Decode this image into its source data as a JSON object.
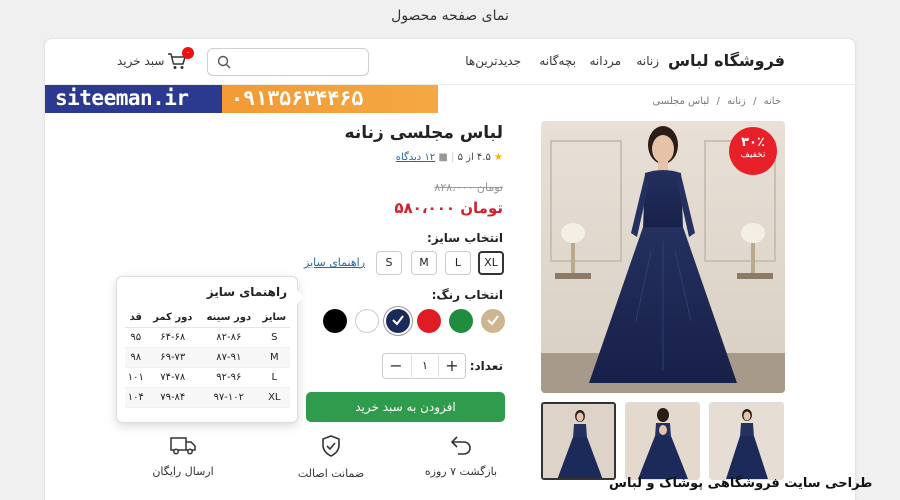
{
  "page_caption": "نمای صفحه محصول",
  "header": {
    "logo": "فروشگاه لباس",
    "nav": [
      {
        "label": "زنانه"
      },
      {
        "label": "مردانه"
      },
      {
        "label": "بچه‌گانه"
      },
      {
        "label": "جدیدترین‌ها"
      }
    ],
    "search_placeholder": "",
    "cart_label": "سبد خرید",
    "cart_count": "۰"
  },
  "banner": {
    "domain": "siteeman.ir",
    "phone": "۰۹۱۳۵۶۳۴۴۶۵"
  },
  "breadcrumb": [
    "خانه",
    "زنانه",
    "لباس مجلسی"
  ],
  "product": {
    "title": "لباس مجلسی زنانه",
    "rating_text": "۴.۵ از ۵",
    "reviews_text": "۱۲ دیدگاه",
    "old_price": "۸۲۸،۰۰۰ تومان",
    "new_price": "۵۸۰،۰۰۰ تومان",
    "discount_pct": "۳۰٪",
    "discount_label": "تخفیف"
  },
  "size_select": {
    "label": "انتخاب سایز:",
    "sizes": [
      "XL",
      "L",
      "M",
      "S"
    ],
    "selected": "XL",
    "guide_link": "راهنمای سایز"
  },
  "color_select": {
    "label": "انتخاب رنگ:",
    "colors": [
      "#cdb590",
      "#1f8c3e",
      "#e01b24",
      "#1c2a59",
      "#ffffff",
      "#000000"
    ],
    "selected_index": 3
  },
  "quantity": {
    "label": "تعداد:",
    "value": "۱"
  },
  "add_to_cart": "افزودن به سبد خرید",
  "features": [
    {
      "icon": "return-icon",
      "label": "بازگشت ۷ روزه"
    },
    {
      "icon": "shield-check-icon",
      "label": "ضمانت اصالت"
    },
    {
      "icon": "truck-icon",
      "label": "ارسال رایگان"
    }
  ],
  "size_guide_popup": {
    "title": "راهنمای سایز",
    "columns": [
      "سایز",
      "دور سینه",
      "دور کمر",
      "قد"
    ],
    "rows": [
      [
        "S",
        "۸۲-۸۶",
        "۶۴-۶۸",
        "۹۵"
      ],
      [
        "M",
        "۸۷-۹۱",
        "۶۹-۷۳",
        "۹۸"
      ],
      [
        "L",
        "۹۲-۹۶",
        "۷۴-۷۸",
        "۱۰۱"
      ],
      [
        "XL",
        "۹۷-۱۰۲",
        "۷۹-۸۴",
        "۱۰۴"
      ]
    ]
  },
  "watermark_caption": "طراحی سایت فروشگاهی پوشاک و لباس"
}
